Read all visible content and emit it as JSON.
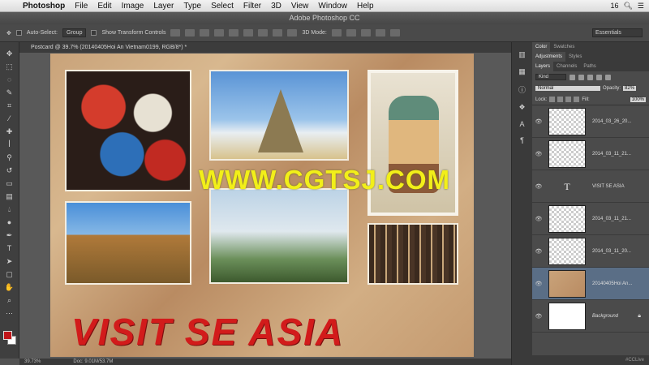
{
  "menubar": {
    "items": [
      "Photoshop",
      "File",
      "Edit",
      "Image",
      "Layer",
      "Type",
      "Select",
      "Filter",
      "3D",
      "View",
      "Window",
      "Help"
    ],
    "date_badge": "16"
  },
  "window": {
    "title": "Adobe Photoshop CC"
  },
  "options_bar": {
    "auto_select_label": "Auto-Select:",
    "auto_select_value": "Group",
    "show_transform_label": "Show Transform Controls",
    "mode_label": "3D Mode:",
    "workspace": "Essentials"
  },
  "document": {
    "tab_label": "Postcard @ 39.7% (20140405Hoi An Vietnam0199, RGB/8*) *",
    "headline": "VISIT SE ASIA",
    "watermark": "WWW.CGTSJ.COM"
  },
  "status_bar": {
    "zoom": "39.73%",
    "doc_size": "Doc: 9.01M/53.7M"
  },
  "panels": {
    "top_tabs": [
      "Color",
      "Swatches"
    ],
    "second_tabs": [
      "Adjustments",
      "Styles"
    ],
    "layer_tabs": [
      "Layers",
      "Channels",
      "Paths"
    ],
    "filter_kind": "Kind",
    "blend_mode": "Normal",
    "opacity_label": "Opacity:",
    "opacity_value": "82%",
    "lock_label": "Lock:",
    "fill_label": "Fill:",
    "fill_value": "100%",
    "layers": [
      {
        "name": "2014_03_26_20...",
        "kind": "smart"
      },
      {
        "name": "2014_03_11_21...",
        "kind": "smart"
      },
      {
        "name": "VISIT SE ASIA",
        "kind": "text"
      },
      {
        "name": "2014_03_11_21...",
        "kind": "smart"
      },
      {
        "name": "2014_03_11_20...",
        "kind": "smart"
      },
      {
        "name": "20140405Hoi An...",
        "kind": "image",
        "selected": true
      },
      {
        "name": "Background",
        "kind": "background"
      }
    ],
    "footer_tag": "#CCLive"
  },
  "icons": [
    "apple-icon",
    "move-tool-icon",
    "marquee-tool-icon",
    "lasso-tool-icon",
    "crop-tool-icon",
    "eyedropper-icon",
    "brush-tool-icon",
    "eraser-icon",
    "type-tool-icon",
    "hand-tool-icon",
    "zoom-tool-icon",
    "eye-icon",
    "lock-icon"
  ]
}
